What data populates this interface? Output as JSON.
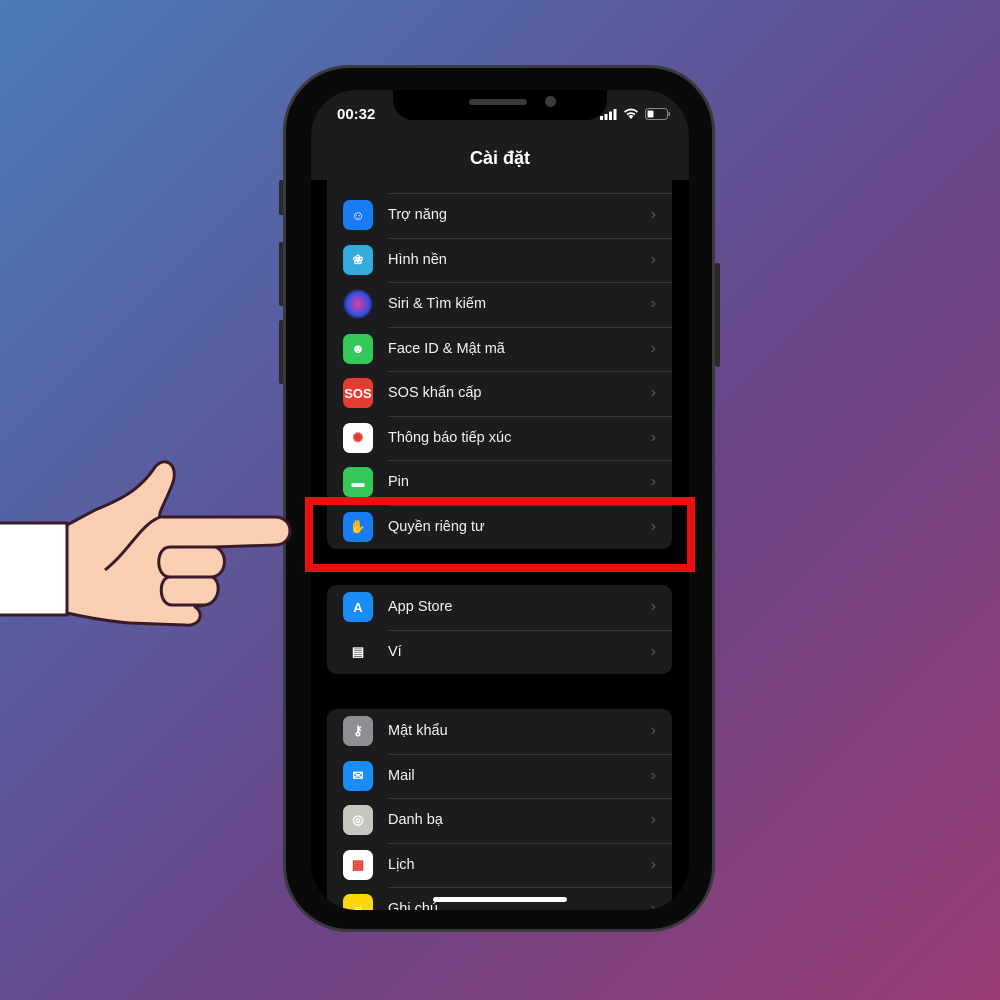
{
  "status_bar": {
    "time": "00:32"
  },
  "header": {
    "title": "Cài đặt"
  },
  "groups": [
    {
      "items": [
        {
          "label": "",
          "icon": "display-icon",
          "color": "#2a5bd7"
        },
        {
          "label": "Trợ năng",
          "icon": "accessibility-icon",
          "color": "#1a7cf2"
        },
        {
          "label": "Hình nền",
          "icon": "wallpaper-flower-icon",
          "color": "#35aadc"
        },
        {
          "label": "Siri & Tìm kiếm",
          "icon": "siri-icon",
          "color": "#111"
        },
        {
          "label": "Face ID & Mật mã",
          "icon": "face-id-icon",
          "color": "#34c759"
        },
        {
          "label": "SOS khẩn cấp",
          "icon": "sos-icon",
          "color": "#e53b30",
          "icon_text": "SOS"
        },
        {
          "label": "Thông báo tiếp xúc",
          "icon": "exposure-notification-icon",
          "color": "#ffffff"
        },
        {
          "label": "Pin",
          "icon": "battery-icon",
          "color": "#34c759"
        },
        {
          "label": "Quyền riêng tư",
          "icon": "privacy-hand-icon",
          "color": "#1a7cf2"
        }
      ]
    },
    {
      "items": [
        {
          "label": "App Store",
          "icon": "app-store-icon",
          "color": "#1a8cf5"
        },
        {
          "label": "Ví",
          "icon": "wallet-icon",
          "color": "#1c1c1e"
        }
      ]
    },
    {
      "items": [
        {
          "label": "Mật khẩu",
          "icon": "key-icon",
          "color": "#8e8e93"
        },
        {
          "label": "Mail",
          "icon": "mail-icon",
          "color": "#1a8cf5"
        },
        {
          "label": "Danh bạ",
          "icon": "contacts-icon",
          "color": "#c8c6c0"
        },
        {
          "label": "Lịch",
          "icon": "calendar-icon",
          "color": "#ffffff"
        },
        {
          "label": "Ghi chú",
          "icon": "notes-icon",
          "color": "#ffd60a"
        }
      ]
    }
  ],
  "highlight_color": "#e8110f"
}
